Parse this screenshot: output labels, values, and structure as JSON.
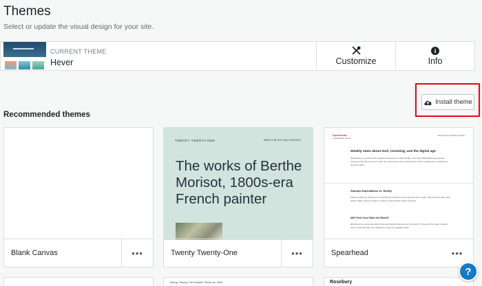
{
  "header": {
    "title": "Themes",
    "subtitle": "Select or update the visual design for your site."
  },
  "current_theme": {
    "label": "CURRENT THEME",
    "name": "Hever",
    "actions": [
      {
        "label": "Customize",
        "icon": "tools-icon"
      },
      {
        "label": "Info",
        "icon": "info-icon"
      }
    ]
  },
  "install": {
    "label": "Install theme",
    "icon": "cloud-upload-icon",
    "highlight_color": "#e30613"
  },
  "recommended": {
    "title": "Recommended themes",
    "more_label": "•••",
    "cards": [
      {
        "name": "Blank Canvas"
      },
      {
        "name": "Twenty Twenty-One",
        "preview": {
          "site_title": "TWENTY TWENTY-ONE",
          "nav": "ABOUT  BLOG  FAQ  CONTACT",
          "headline": "The works of Berthe Morisot, 1800s-era French painter"
        }
      },
      {
        "name": "Spearhead",
        "preview": {
          "brand": "Spearhead",
          "tagline": "A podcasting theme",
          "nav": "Home  About  Podcast  Contact",
          "headline": "Weekly news about tech, investing, and the digital age",
          "intro": "Spearhead is a weekly tech podcast released every Wednesday. Join hosts Matt Mullenweg and Ian Chong as they dive into hot trends, the hottest tech news, and discover which startups are most likely to succeed. More",
          "post1_title": "Startups Expectations vs. Reality",
          "post1_text": "Startup culture is notorious for pressuring founders to move fast and have a plan. This week we talk about what it really means to build a company and what the reality looks like.",
          "post2_title": "Will Tech Over Rule the World?",
          "post2_text": "Should we be concerned about how technology influences our decisions? Our guest this week explains how our favorite apps are designed to keep us engaged. More"
        }
      }
    ],
    "bottom_peeks": [
      {
        "text": "Twenty Twenty  The Default Theme for 2020"
      },
      {
        "text": ""
      },
      {
        "text": "Rosebury"
      }
    ]
  },
  "help": {
    "label": "?"
  },
  "colors": {
    "accent": "#117ac9",
    "background": "#f6f7f7",
    "preview_green": "#d1e4dd",
    "highlight": "#e30613"
  }
}
